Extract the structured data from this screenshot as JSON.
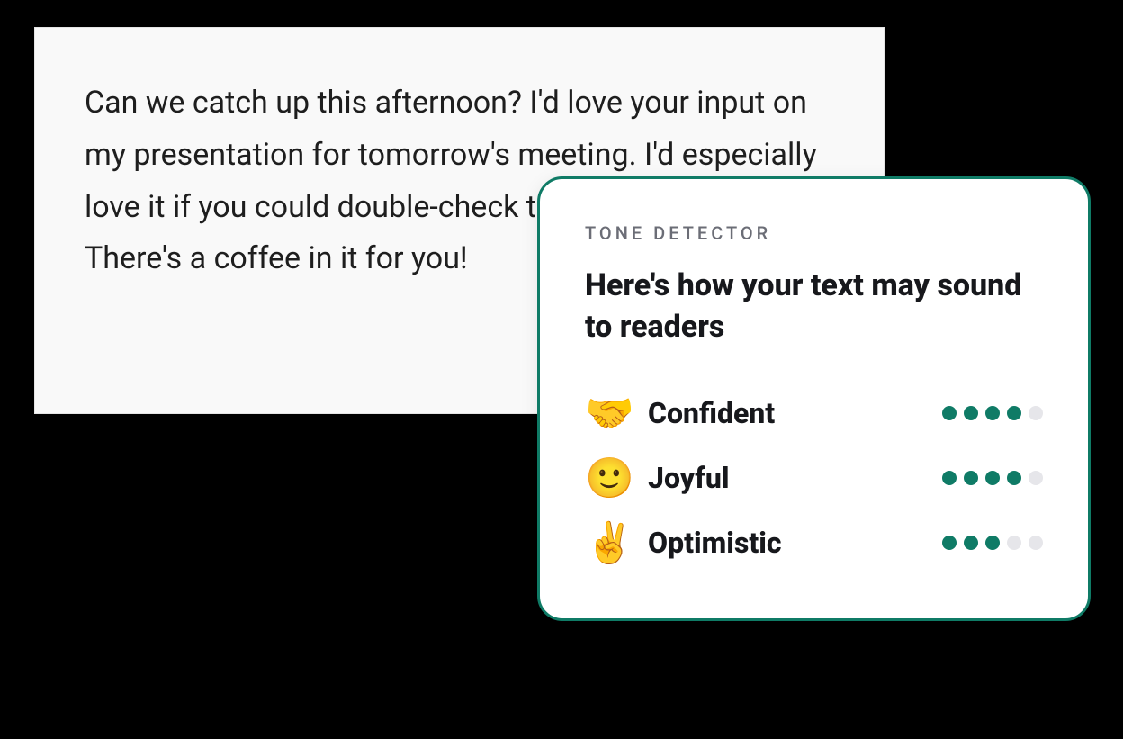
{
  "textPanel": {
    "body": "Can we catch up this afternoon? I'd love your input on my presentation for tomorrow's meeting. I'd especially love it if you could double-check the sales numbers. There's a coffee in it for you!"
  },
  "detector": {
    "overline": "TONE DETECTOR",
    "heading": "Here's how your text may sound to readers",
    "tones": [
      {
        "emoji": "🤝",
        "label": "Confident",
        "score": 4,
        "max": 5
      },
      {
        "emoji": "🙂",
        "label": "Joyful",
        "score": 4,
        "max": 5
      },
      {
        "emoji": "✌️",
        "label": "Optimistic",
        "score": 3,
        "max": 5
      }
    ]
  },
  "colors": {
    "accent": "#0f7b66",
    "panelBg": "#f9f9f9",
    "cardBg": "#ffffff",
    "bodyBg": "#000000"
  }
}
